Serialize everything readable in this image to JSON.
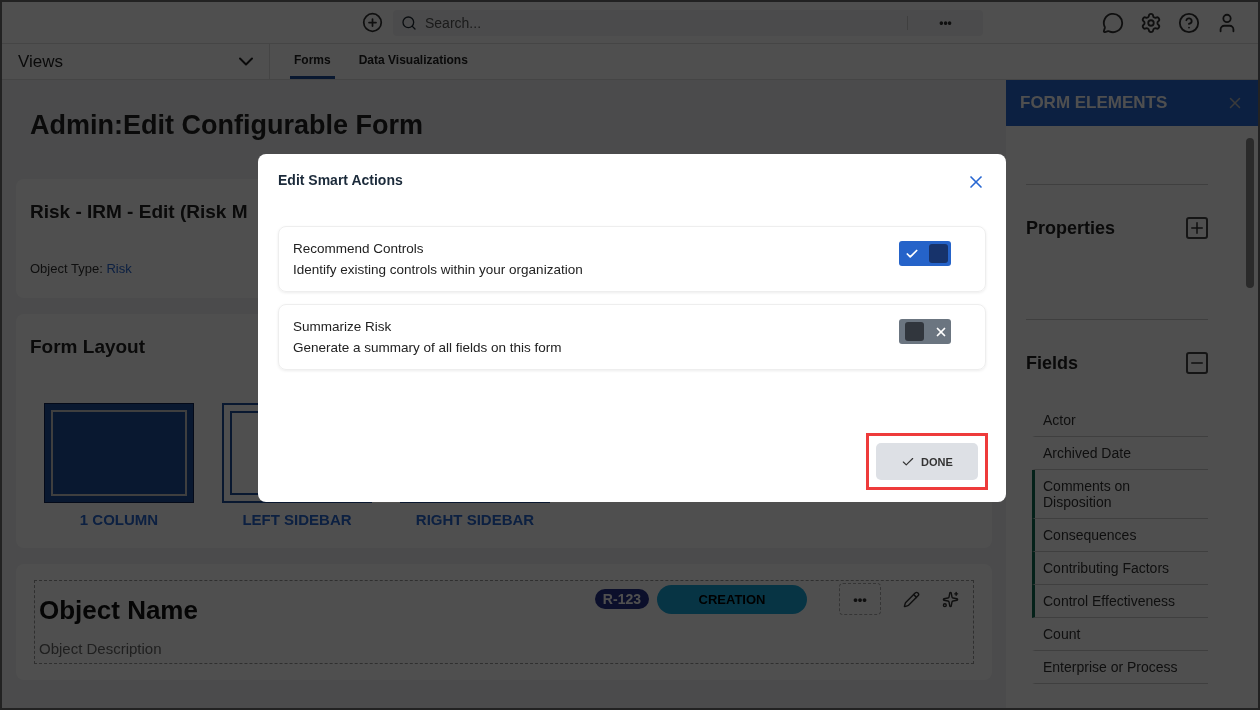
{
  "top_bar": {
    "search": {
      "placeholder": "Search..."
    },
    "more": "•••"
  },
  "nav": {
    "views": "Views",
    "tabs": [
      {
        "label": "Forms",
        "selected": true
      },
      {
        "label": "Data Visualizations",
        "selected": false
      }
    ]
  },
  "page": {
    "title": "Admin:Edit Configurable Form",
    "form_card": {
      "name": "Risk - IRM - Edit (Risk M",
      "object_type_label": "Object Type:",
      "object_type": "Risk"
    },
    "layout_card": {
      "title": "Form Layout",
      "options": [
        {
          "label": "1 COLUMN",
          "kind": "single",
          "selected": true
        },
        {
          "label": "LEFT SIDEBAR",
          "kind": "left",
          "selected": false
        },
        {
          "label": "RIGHT SIDEBAR",
          "kind": "right",
          "selected": false
        }
      ]
    },
    "object_card": {
      "name": "Object Name",
      "description": "Object Description",
      "badge": "R-123",
      "status": "CREATION",
      "more": "•••"
    }
  },
  "form_elements": {
    "title": "FORM ELEMENTS",
    "sections": [
      {
        "title": "Properties",
        "expanded": false
      },
      {
        "title": "Fields",
        "expanded": true
      }
    ],
    "fields": [
      {
        "label": "Actor",
        "marked": false
      },
      {
        "label": "Archived Date",
        "marked": false
      },
      {
        "label": "Comments on Disposition",
        "marked": true
      },
      {
        "label": "Consequences",
        "marked": true
      },
      {
        "label": "Contributing Factors",
        "marked": true
      },
      {
        "label": "Control Effectiveness",
        "marked": true
      },
      {
        "label": "Count",
        "marked": false
      },
      {
        "label": "Enterprise or Process",
        "marked": false
      }
    ]
  },
  "dialog": {
    "title": "Edit Smart Actions",
    "actions": [
      {
        "name": "Recommend Controls",
        "description": "Identify existing controls within your organization",
        "on": true
      },
      {
        "name": "Summarize Risk",
        "description": "Generate a summary of all fields on this form",
        "on": false
      }
    ],
    "done": "DONE",
    "done_highlighted": true
  }
}
